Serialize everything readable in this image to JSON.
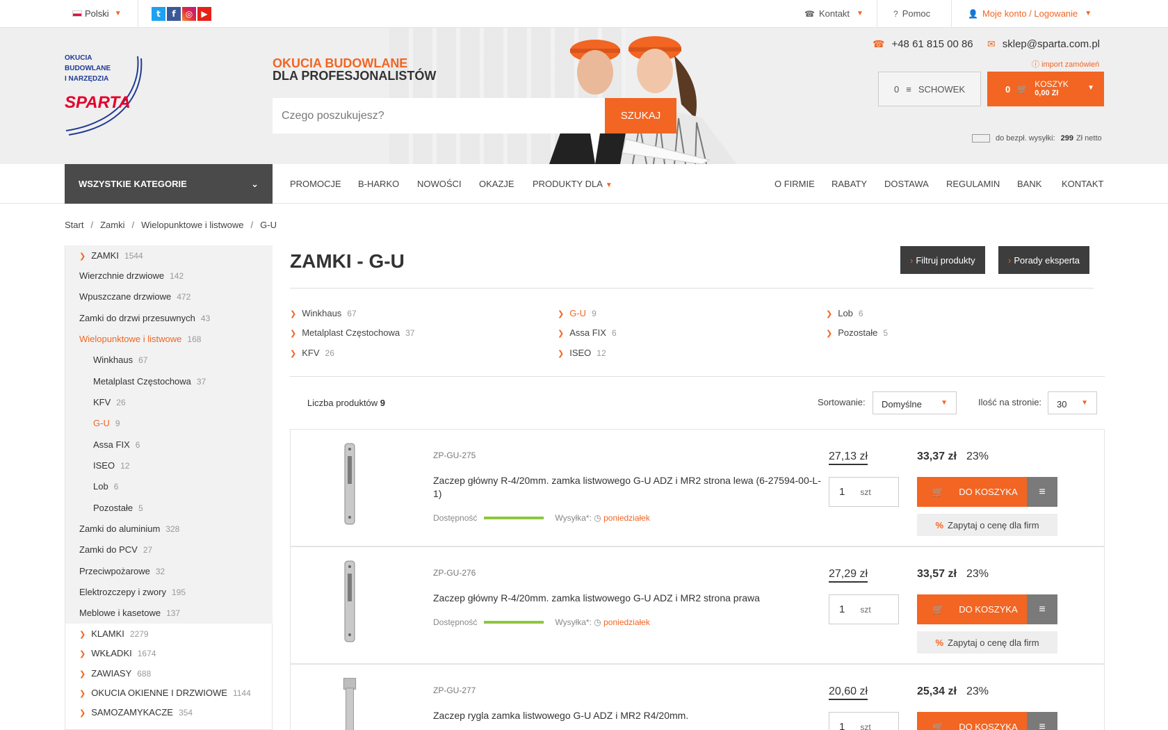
{
  "topbar": {
    "language": "Polski",
    "contact": "Kontakt",
    "help": "Pomoc",
    "account": "Moje konto / Logowanie"
  },
  "header": {
    "logo_lines": [
      "OKUCIA",
      "BUDOWLANE",
      "I NARZĘDZIA"
    ],
    "logo_brand": "SPARTA",
    "tagline_1": "OKUCIA BUDOWLANE",
    "tagline_2": "DLA PROFESJONALISTÓW",
    "search_placeholder": "Czego poszukujesz?",
    "search_button": "SZUKAJ",
    "phone": "+48 61 815 00 86",
    "email": "sklep@sparta.com.pl",
    "import_orders": "import zamówień",
    "schowek_count": "0",
    "schowek_label": "SCHOWEK",
    "cart_count": "0",
    "cart_label": "KOSZYK",
    "cart_total": "0,00 Zł",
    "free_shipping_prefix": "do bezpł. wysyłki:",
    "free_shipping_amount": "299",
    "free_shipping_suffix": "Zł netto"
  },
  "nav": {
    "all_categories": "WSZYSTKIE KATEGORIE",
    "left": [
      "PROMOCJE",
      "B-HARKO",
      "NOWOŚCI",
      "OKAZJE",
      "PRODUKTY DLA"
    ],
    "right": [
      "O FIRMIE",
      "RABATY",
      "DOSTAWA",
      "REGULAMIN",
      "BANK",
      "KONTAKT"
    ]
  },
  "breadcrumb": [
    "Start",
    "Zamki",
    "Wielopunktowe i listwowe",
    "G-U"
  ],
  "sidebar": {
    "top": {
      "label": "ZAMKI",
      "count": "1544"
    },
    "level1": [
      {
        "label": "Wierzchnie drzwiowe",
        "count": "142"
      },
      {
        "label": "Wpuszczane drzwiowe",
        "count": "472"
      },
      {
        "label": "Zamki do drzwi przesuwnych",
        "count": "43"
      },
      {
        "label": "Wielopunktowe i listwowe",
        "count": "168"
      }
    ],
    "level2": [
      {
        "label": "Winkhaus",
        "count": "67"
      },
      {
        "label": "Metalplast Częstochowa",
        "count": "37"
      },
      {
        "label": "KFV",
        "count": "26"
      },
      {
        "label": "G-U",
        "count": "9"
      },
      {
        "label": "Assa FIX",
        "count": "6"
      },
      {
        "label": "ISEO",
        "count": "12"
      },
      {
        "label": "Lob",
        "count": "6"
      },
      {
        "label": "Pozostałe",
        "count": "5"
      }
    ],
    "level1_after": [
      {
        "label": "Zamki do aluminium",
        "count": "328"
      },
      {
        "label": "Zamki do PCV",
        "count": "27"
      },
      {
        "label": "Przeciwpożarowe",
        "count": "32"
      },
      {
        "label": "Elektrozczepy i zwory",
        "count": "195"
      },
      {
        "label": "Meblowe i kasetowe",
        "count": "137"
      }
    ],
    "categories": [
      {
        "label": "KLAMKI",
        "count": "2279"
      },
      {
        "label": "WKŁADKI",
        "count": "1674"
      },
      {
        "label": "ZAWIASY",
        "count": "688"
      },
      {
        "label": "OKUCIA OKIENNE I DRZWIOWE",
        "count": "1144"
      },
      {
        "label": "SAMOZAMYKACZE",
        "count": "354"
      }
    ]
  },
  "main": {
    "title": "ZAMKI - G-U",
    "filter_button": "Filtruj produkty",
    "expert_button": "Porady eksperta",
    "subcategories": [
      {
        "label": "Winkhaus",
        "count": "67"
      },
      {
        "label": "Metalplast Częstochowa",
        "count": "37"
      },
      {
        "label": "KFV",
        "count": "26"
      },
      {
        "label": "G-U",
        "count": "9"
      },
      {
        "label": "Assa FIX",
        "count": "6"
      },
      {
        "label": "ISEO",
        "count": "12"
      },
      {
        "label": "Lob",
        "count": "6"
      },
      {
        "label": "Pozostałe",
        "count": "5"
      }
    ],
    "count_label": "Liczba produktów",
    "count_value": "9",
    "sort_label": "Sortowanie:",
    "sort_value": "Domyślne",
    "perpage_label": "Ilość na stronie:",
    "perpage_value": "30"
  },
  "product_labels": {
    "availability": "Dostępność",
    "shipping": "Wysyłka*:",
    "unit": "szt",
    "add_to_cart": "DO KOSZYKA",
    "ask_price": "Zapytaj o cenę dla firm",
    "percent": "%"
  },
  "products": [
    {
      "sku": "ZP-GU-275",
      "name": "Zaczep główny R-4/20mm. zamka listwowego G-U ADZ i MR2 strona lewa (6-27594-00-L-1)",
      "netto": "27,13 zł",
      "brutto": "33,37 zł",
      "vat": "23%",
      "qty": "1",
      "ship_day": "poniedziałek"
    },
    {
      "sku": "ZP-GU-276",
      "name": "Zaczep główny R-4/20mm. zamka listwowego G-U ADZ i MR2 strona prawa",
      "netto": "27,29 zł",
      "brutto": "33,57 zł",
      "vat": "23%",
      "qty": "1",
      "ship_day": "poniedziałek"
    },
    {
      "sku": "ZP-GU-277",
      "name": "Zaczep rygla zamka listwowego G-U ADZ i MR2 R4/20mm.",
      "netto": "20,60 zł",
      "brutto": "25,34 zł",
      "vat": "23%",
      "qty": "1",
      "ship_day": ""
    }
  ],
  "colors": {
    "accent": "#f26522",
    "dark": "#3d3d3d",
    "availability": "#8dc63f"
  },
  "icons": [
    "twitter-icon",
    "facebook-icon",
    "instagram-icon",
    "youtube-icon",
    "phone-icon",
    "help-icon",
    "user-icon",
    "mail-icon",
    "cart-icon",
    "list-icon",
    "clock-icon"
  ]
}
